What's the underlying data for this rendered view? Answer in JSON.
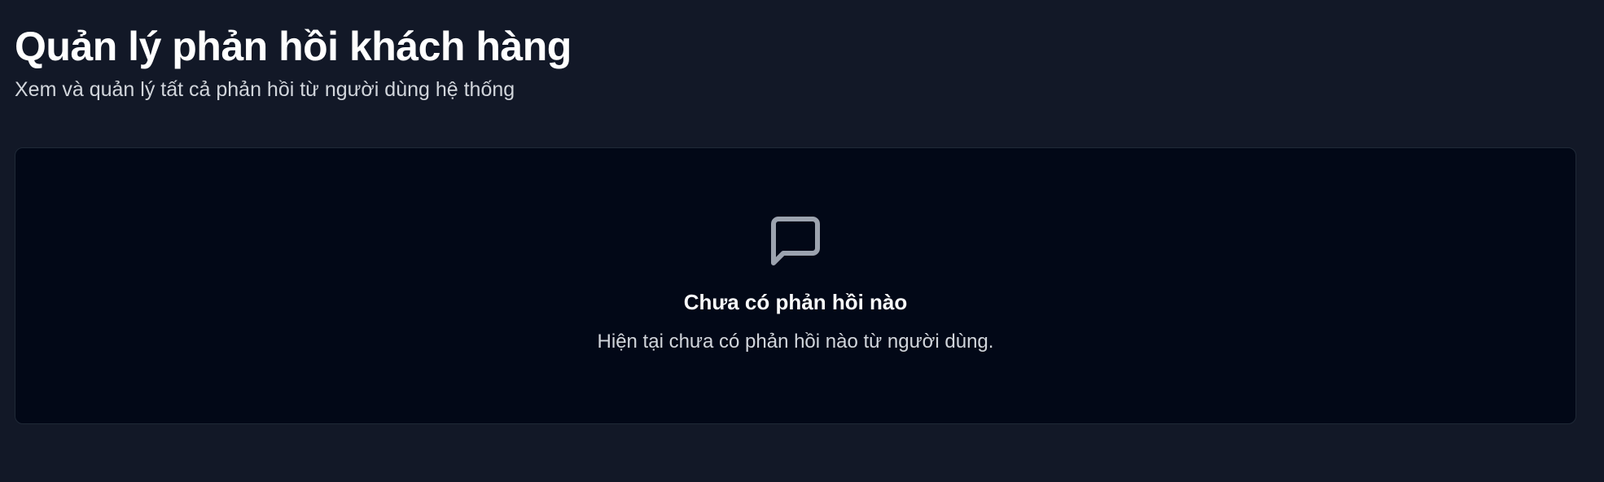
{
  "header": {
    "title": "Quản lý phản hồi khách hàng",
    "subtitle": "Xem và quản lý tất cả phản hồi từ người dùng hệ thống"
  },
  "empty_state": {
    "icon": "message-square-icon",
    "title": "Chưa có phản hồi nào",
    "description": "Hiện tại chưa có phản hồi nào từ người dùng."
  },
  "colors": {
    "page_background": "#121827",
    "card_background": "#020817",
    "card_border": "#1f2937",
    "icon_color": "#9ca3af",
    "text_primary": "#ffffff",
    "text_secondary": "#d1d5db"
  }
}
